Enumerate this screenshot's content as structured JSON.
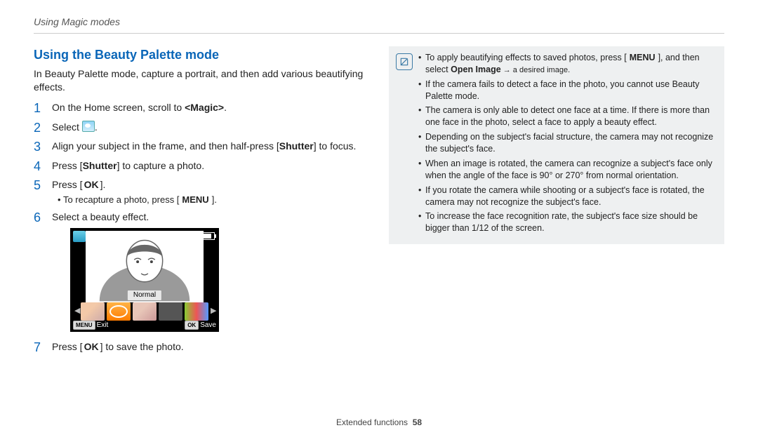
{
  "header": "Using Magic modes",
  "title": "Using the Beauty Palette mode",
  "intro": "In Beauty Palette mode, capture a portrait, and then add various beautifying effects.",
  "steps": {
    "s1": {
      "pre": "On the Home screen, scroll to ",
      "bold": "<Magic>",
      "post": "."
    },
    "s2": {
      "pre": "Select ",
      "post": "."
    },
    "s3": {
      "pre": "Align your subject in the frame, and then half-press [",
      "bold": "Shutter",
      "post": "] to focus."
    },
    "s4": {
      "pre": "Press [",
      "bold": "Shutter",
      "post": "] to capture a photo."
    },
    "s5": {
      "pre": "Press [",
      "key": "OK",
      "post": "]."
    },
    "s5_sub": {
      "pre": "To recapture a photo, press [",
      "key": "MENU",
      "post": "]."
    },
    "s6": "Select a beauty effect.",
    "s7": {
      "pre": "Press [",
      "key": "OK",
      "post": "] to save the photo."
    }
  },
  "camera": {
    "count": "1",
    "effect_label": "Normal",
    "exit_key": "MENU",
    "exit_label": "Exit",
    "save_key": "OK",
    "save_label": "Save"
  },
  "notes": {
    "n1": {
      "a": "To apply beautifying effects to saved photos, press [",
      "key": "MENU",
      "b": "], and then select ",
      "bold": "Open Image",
      "c": " → a desired image."
    },
    "n2": "If the camera fails to detect a face in the photo, you cannot use Beauty Palette mode.",
    "n3": "The camera is only able to detect one face at a time. If there is more than one face in the photo, select a face to apply a beauty effect.",
    "n4": "Depending on the subject's facial structure, the camera may not recognize the subject's face.",
    "n5": "When an image is rotated, the camera can recognize a subject's face only when the angle of the face is 90° or 270° from normal orientation.",
    "n6": "If you rotate the camera while shooting or a subject's face is rotated, the camera may not recognize the subject's face.",
    "n7": "To increase the face recognition rate, the subject's face size should be bigger than 1/12 of the screen."
  },
  "footer": {
    "section": "Extended functions",
    "page": "58"
  }
}
